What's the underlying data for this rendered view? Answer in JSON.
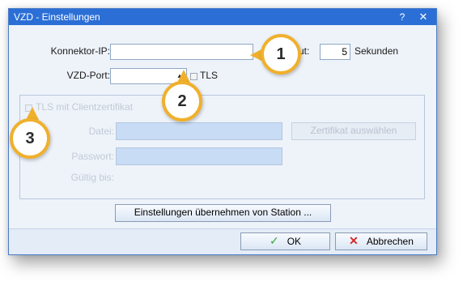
{
  "window": {
    "title": "VZD - Einstellungen",
    "help_glyph": "?",
    "close_glyph": "✕"
  },
  "form": {
    "connector_ip_label": "Konnektor-IP:",
    "connector_ip_value": "",
    "timeout_label_visible": "ut:",
    "timeout_value": "5",
    "timeout_unit": "Sekunden",
    "port_label": "VZD-Port:",
    "port_value": "",
    "tls_label": "TLS"
  },
  "client_cert": {
    "checkbox_label": "TLS mit Clientzertifikat",
    "file_label": "Datei:",
    "password_label": "Passwort:",
    "valid_until_label": "Gültig bis:",
    "select_cert_button": "Zertifikat auswählen"
  },
  "buttons": {
    "apply_from_station": "Einstellungen übernehmen von Station ...",
    "ok": "OK",
    "cancel": "Abbrechen",
    "ok_icon": "checkmark-icon",
    "cancel_icon": "cross-icon"
  },
  "callouts": [
    "1",
    "2",
    "3"
  ],
  "colors": {
    "titlebar": "#2b6fd6",
    "callout_border": "#f0b02c",
    "dialog_bg": "#eef3fa"
  }
}
